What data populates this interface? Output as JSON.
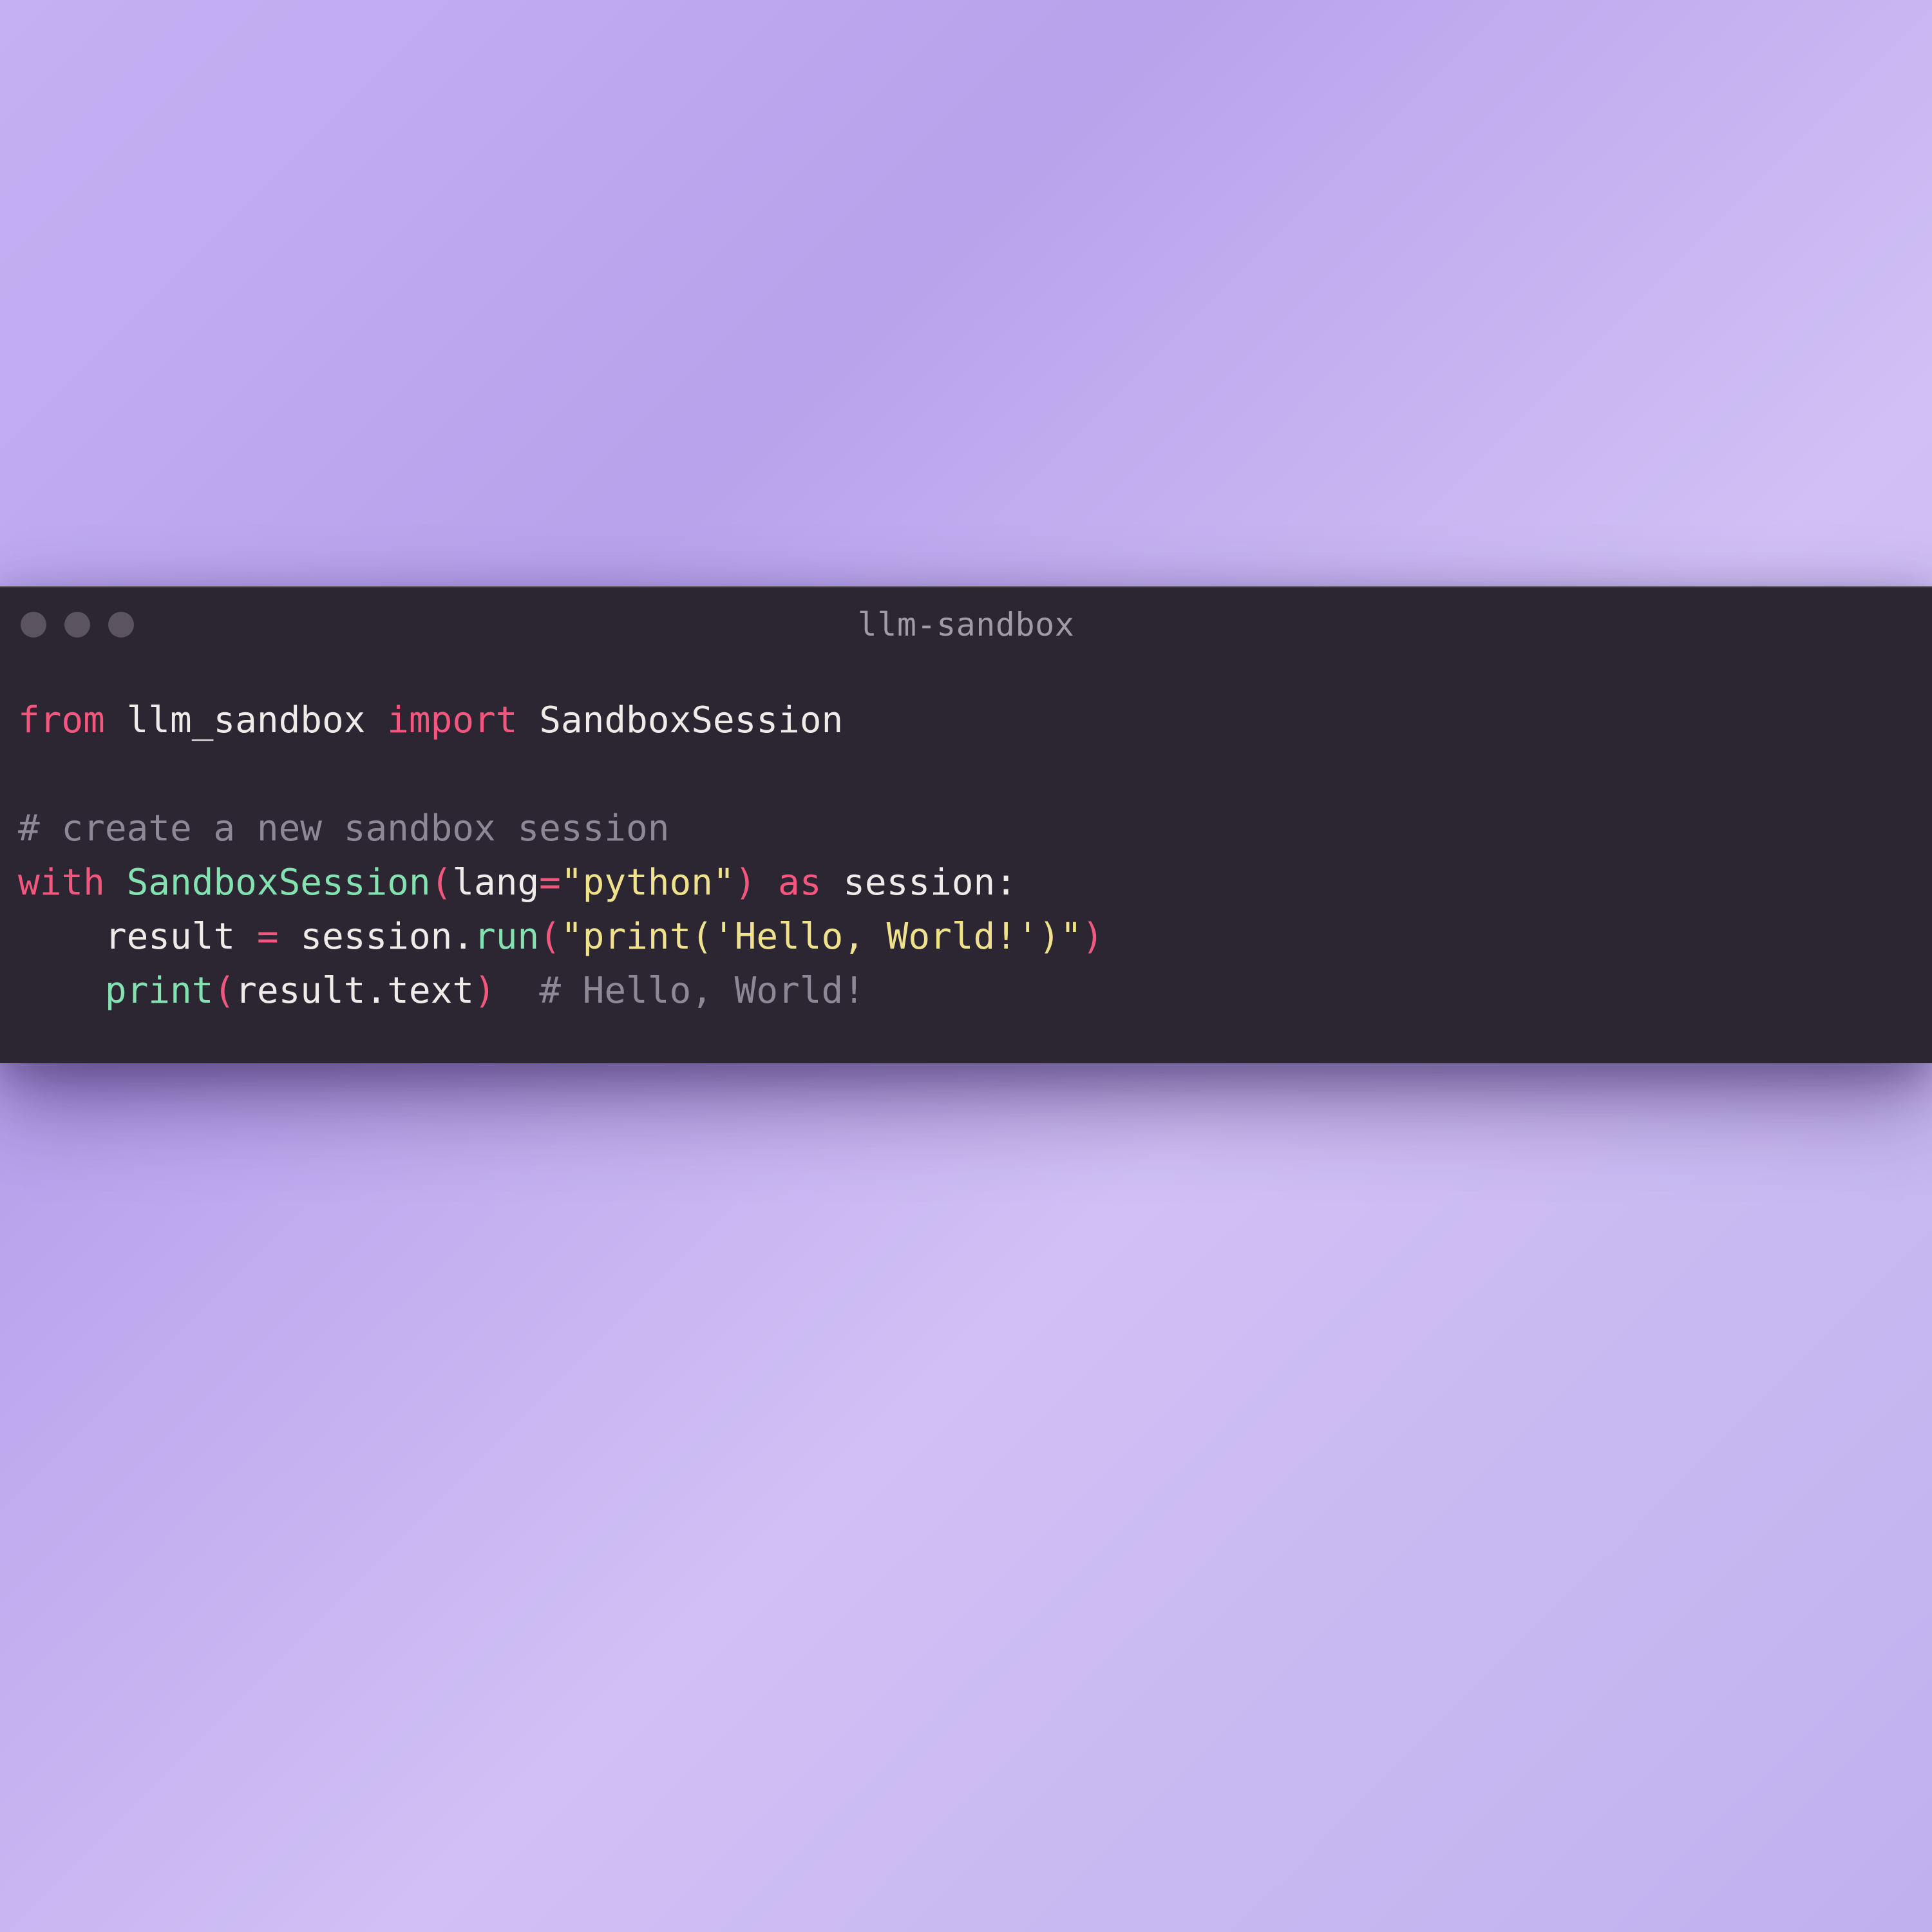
{
  "window": {
    "title": "llm-sandbox"
  },
  "code": {
    "line1": {
      "kw_from": "from",
      "module": "llm_sandbox",
      "kw_import": "import",
      "classname": "SandboxSession"
    },
    "line3": {
      "comment": "# create a new sandbox session"
    },
    "line4": {
      "kw_with": "with",
      "ctor": "SandboxSession",
      "lparen": "(",
      "argname": "lang",
      "eq": "=",
      "argval": "\"python\"",
      "rparen": ")",
      "kw_as": "as",
      "varname": "session",
      "colon": ":"
    },
    "line5": {
      "indent": "    ",
      "target": "result",
      "eq": "=",
      "obj": "session",
      "dot": ".",
      "method": "run",
      "lparen": "(",
      "arg": "\"print('Hello, World!')\"",
      "rparen": ")"
    },
    "line6": {
      "indent": "    ",
      "fn": "print",
      "lparen": "(",
      "obj": "result",
      "dot": ".",
      "attr": "text",
      "rparen": ")",
      "gap": "  ",
      "comment": "# Hello, World!"
    }
  }
}
